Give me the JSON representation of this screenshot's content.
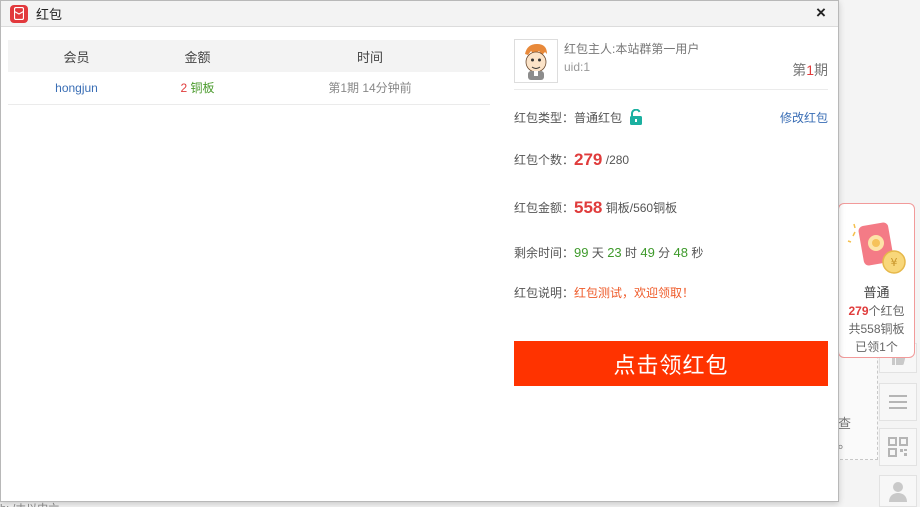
{
  "window": {
    "title": "红包",
    "close_label": "×"
  },
  "table": {
    "headers": [
      "会员",
      "金额",
      "时间"
    ],
    "rows": [
      {
        "member": "hongjun",
        "amount": "2",
        "unit": "铜板",
        "time": "第1期 14分钟前"
      }
    ]
  },
  "owner": {
    "name": "红包主人:本站群第一用户",
    "uid": "uid:1",
    "period_prefix": "第",
    "period_num": "1",
    "period_suffix": "期"
  },
  "info": {
    "type_label": "红包类型：",
    "type_value": "普通红包",
    "edit_label": "修改红包",
    "count_label": "红包个数：",
    "count_remaining": "279",
    "count_total": "/280",
    "amount_label": "红包金额：",
    "amount_remaining": "558",
    "amount_rest": "铜板/560铜板",
    "remain_label": "剩余时间：",
    "days": "99",
    "days_unit": "天",
    "hours": "23",
    "hours_unit": "时",
    "minutes": "49",
    "minutes_unit": "分",
    "seconds": "48",
    "seconds_unit": "秒",
    "desc_label": "红包说明：",
    "desc_value": "红包测试，欢迎领取！",
    "grab_button": "点击领红包"
  },
  "widget": {
    "type": "普通",
    "count_num": "279",
    "count_text": "个红包",
    "total": "共558铜板",
    "claimed": "已领1个"
  },
  "background": {
    "text_fragment": "查\n。",
    "bottom_fragment": "b: /ホ以中六"
  },
  "colors": {
    "accent_red": "#e03c3c",
    "button_red": "#ff3300",
    "link_blue": "#3a6eb5",
    "green": "#3e9a2b",
    "lock_teal": "#1bb0a0"
  },
  "icons": {
    "app": "red-packet-icon",
    "lock": "unlock-icon",
    "side_tools": [
      "like-icon",
      "menu-icon",
      "qr-code-icon",
      "user-icon"
    ]
  }
}
